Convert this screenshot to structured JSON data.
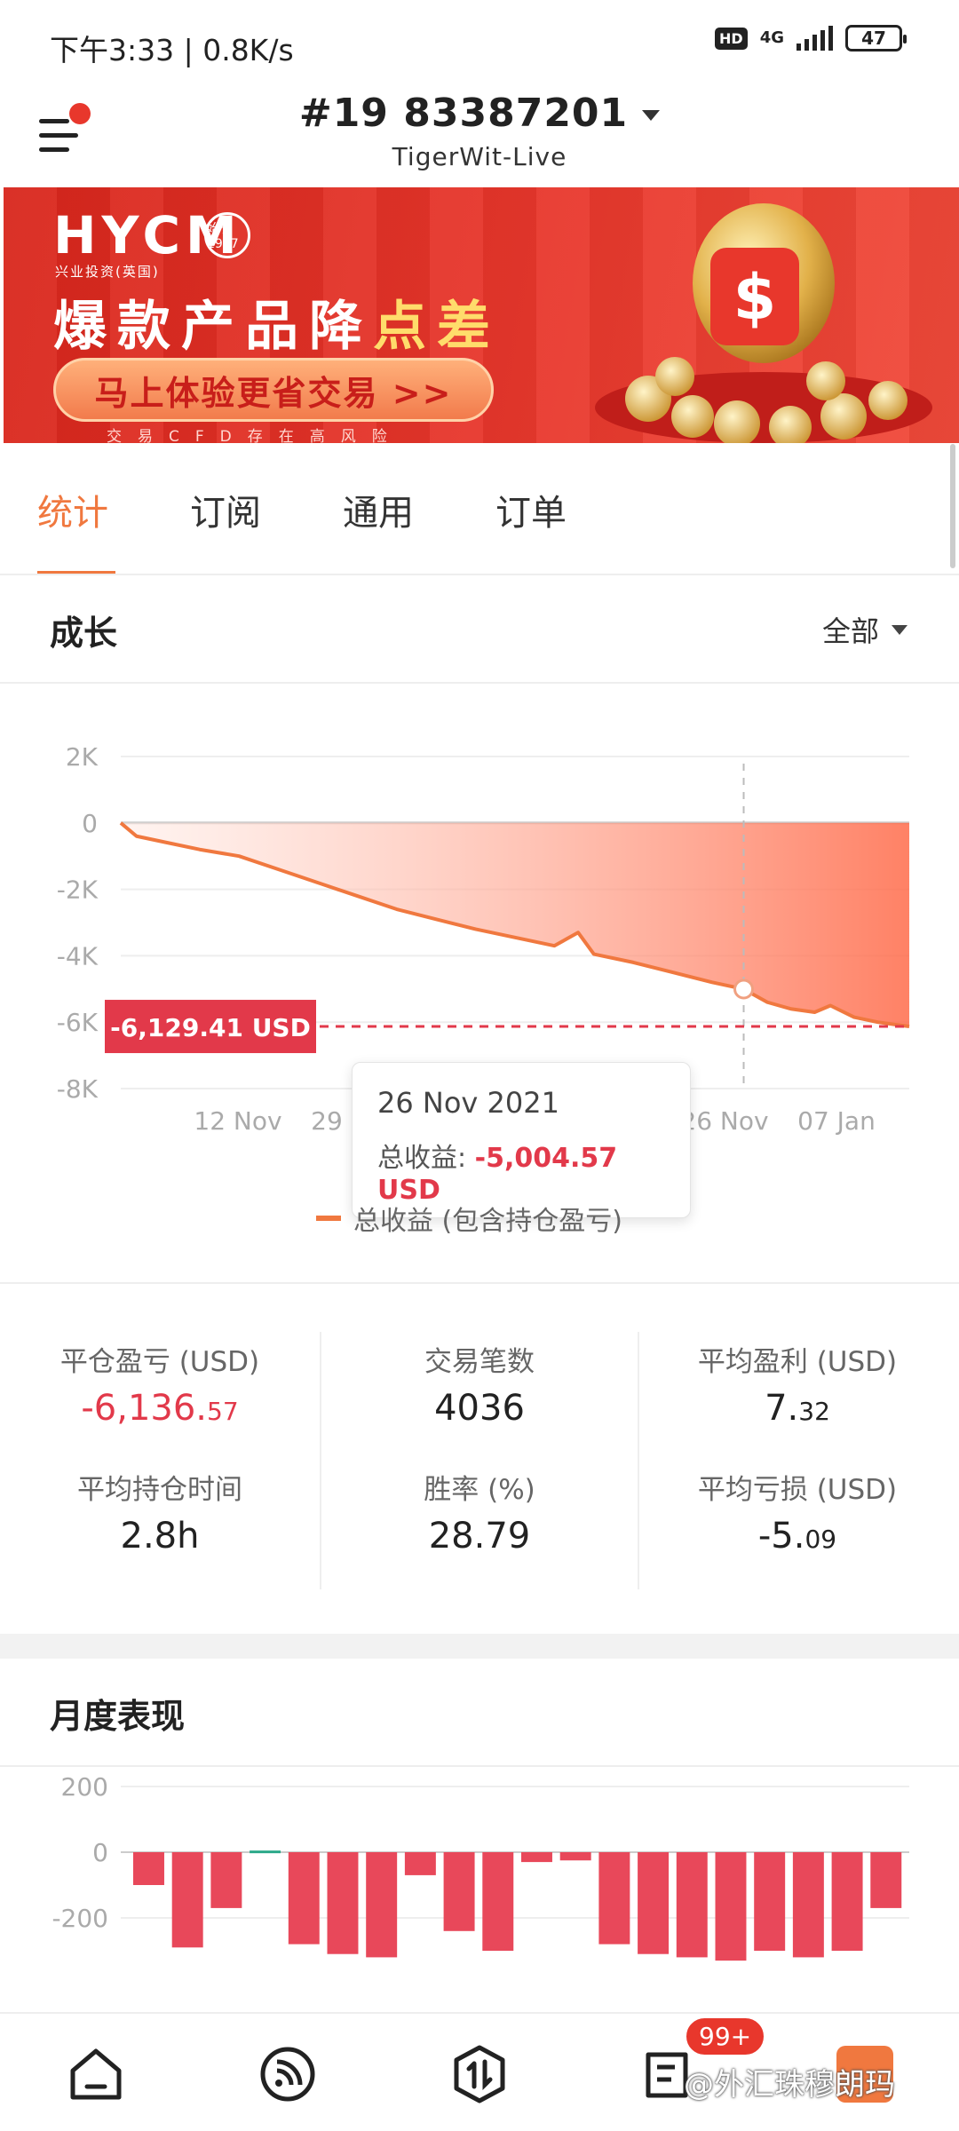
{
  "status_bar": {
    "text": "下午3:33 | 0.8K/s",
    "hd": "HD",
    "network": "4G",
    "battery": "47"
  },
  "header": {
    "account": "#19 83387201",
    "server": "TigerWit-Live"
  },
  "banner": {
    "brand": "HYCM",
    "brand_sub": "兴业投资(英国)",
    "seal": "始于1977",
    "headline_prefix": "爆款产品降",
    "headline_highlight": "点差",
    "cta": "马上体验更省交易 >>",
    "risk": "交易CFD存在高风险"
  },
  "tabs": [
    {
      "label": "统计",
      "active": true
    },
    {
      "label": "订阅",
      "active": false
    },
    {
      "label": "通用",
      "active": false
    },
    {
      "label": "订单",
      "active": false
    }
  ],
  "growth": {
    "title": "成长",
    "filter": "全部",
    "current_label": "-6,129.41 USD",
    "tooltip_date": "26 Nov 2021",
    "tooltip_label": "总收益: ",
    "tooltip_value": "-5,004.57 USD",
    "legend": "总收益 (包含持仓盈亏)"
  },
  "chart_data": [
    {
      "type": "area",
      "title": "成长",
      "y_ticks": [
        "2K",
        "0",
        "-2K",
        "-4K",
        "-6K",
        "-8K"
      ],
      "ylim": [
        -8000,
        2000
      ],
      "x_ticks": [
        "12 Nov",
        "29",
        "26 Nov",
        "07 Jan"
      ],
      "series": [
        {
          "name": "总收益 (包含持仓盈亏)",
          "x": [
            0,
            0.02,
            0.06,
            0.1,
            0.15,
            0.2,
            0.25,
            0.3,
            0.35,
            0.4,
            0.45,
            0.5,
            0.55,
            0.58,
            0.6,
            0.65,
            0.7,
            0.75,
            0.79,
            0.82,
            0.85,
            0.88,
            0.9,
            0.93,
            0.96,
            1.0
          ],
          "values": [
            0,
            -400,
            -600,
            -800,
            -1000,
            -1400,
            -1800,
            -2200,
            -2600,
            -2900,
            -3200,
            -3450,
            -3700,
            -3300,
            -3950,
            -4200,
            -4500,
            -4800,
            -5004.57,
            -5400,
            -5600,
            -5700,
            -5500,
            -5850,
            -6000,
            -6129.41
          ]
        }
      ],
      "highlight": {
        "label": "26 Nov 2021",
        "value": -5004.57
      },
      "current_value": -6129.41
    },
    {
      "type": "bar",
      "title": "月度表现",
      "y_ticks": [
        "200",
        "0",
        "-200"
      ],
      "ylim": [
        -300,
        250
      ],
      "values": [
        -100,
        -290,
        -170,
        5,
        -280,
        -310,
        -320,
        -70,
        -240,
        -300,
        -30,
        -25,
        -280,
        -310,
        -320,
        -330,
        -300,
        -320,
        -300,
        -170
      ]
    }
  ],
  "stats": [
    {
      "label": "平仓盈亏 (USD)",
      "main": "-6,136.",
      "frac": "57",
      "negative": true
    },
    {
      "label": "交易笔数",
      "main": "4036",
      "frac": "",
      "negative": false
    },
    {
      "label": "平均盈利 (USD)",
      "main": "7.",
      "frac": "32",
      "negative": false
    },
    {
      "label": "平均持仓时间",
      "main": "2.8h",
      "frac": "",
      "negative": false
    },
    {
      "label": "胜率 (%)",
      "main": "28.79",
      "frac": "",
      "negative": false
    },
    {
      "label": "平均亏损 (USD)",
      "main": "-5.",
      "frac": "09",
      "negative": false
    }
  ],
  "monthly": {
    "title": "月度表现"
  },
  "nav": {
    "badge": "99+",
    "watermark": "@外汇珠穆朗玛"
  },
  "colors": {
    "accent": "#f0783f",
    "negative": "#e2394a",
    "bar": "#e8485a",
    "bar_positive": "#2aa889"
  }
}
